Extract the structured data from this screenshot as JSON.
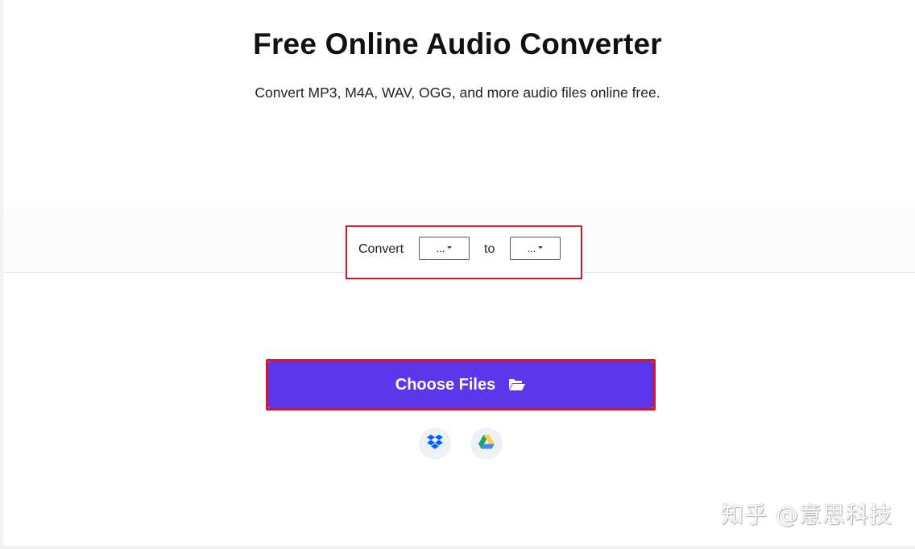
{
  "header": {
    "title": "Free Online Audio Converter",
    "subtitle": "Convert MP3, M4A, WAV, OGG, and more audio files online free."
  },
  "converter": {
    "convert_label": "Convert",
    "from_value": "...",
    "to_label": "to",
    "to_value": "..."
  },
  "upload": {
    "choose_files_label": "Choose Files",
    "icon": "folder-open-icon",
    "cloud_sources": [
      "dropbox-icon",
      "google-drive-icon"
    ]
  },
  "watermark": {
    "text": "知乎 @意思科技"
  },
  "colors": {
    "accent": "#5c36ea",
    "highlight_border": "#d0192a",
    "dropbox_blue": "#0061fe",
    "drive_green": "#1fa463",
    "drive_yellow": "#ffd04b",
    "drive_blue": "#4688f4"
  }
}
